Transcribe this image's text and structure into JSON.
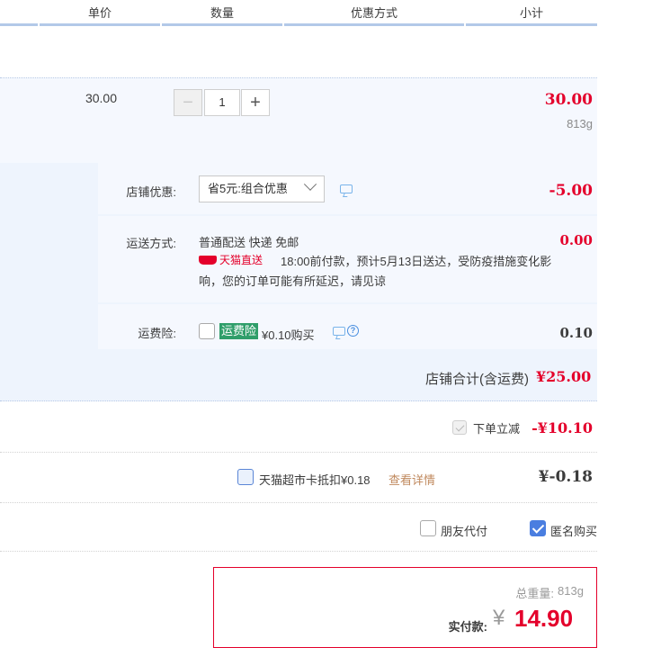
{
  "header": {
    "col_price": "单价",
    "col_qty": "数量",
    "col_discount": "优惠方式",
    "col_subtotal": "小计"
  },
  "item": {
    "unit_price": "30.00",
    "qty_minus": "−",
    "quantity": "1",
    "qty_plus": "+",
    "subtotal": "30.00",
    "weight": "813g"
  },
  "shop_discount": {
    "label": "店铺优惠:",
    "selected": "省5元:组合优惠",
    "amount": "-5.00"
  },
  "shipping": {
    "label": "运送方式:",
    "method": "普通配送 快递 免邮",
    "badge": "天猫直送",
    "notice_line1": "18:00前付款，预计5月13日送达，受防疫措施变化影",
    "notice_line2": "响，您的订单可能有所延迟，请见谅",
    "amount": "0.00"
  },
  "insurance": {
    "label": "运费险:",
    "badge": "运费险",
    "price_text": "¥0.10购买",
    "help_glyph": "?",
    "amount": "0.10"
  },
  "shop_total": {
    "label": "店铺合计(含运费)",
    "amount": "¥25.00"
  },
  "instant_discount": {
    "label": "下单立减",
    "amount": "-¥10.10"
  },
  "supermarket_card": {
    "label": "天猫超市卡抵扣¥0.18",
    "details_link": "查看详情",
    "amount": "¥-0.18"
  },
  "options": {
    "friend_pay": "朋友代付",
    "anonymous": "匿名购买"
  },
  "summary": {
    "weight_label": "总重量:",
    "weight_value": "813g",
    "pay_label": "实付款:",
    "currency": "¥",
    "pay_amount": "14.90"
  },
  "colors": {
    "accent_red": "#e4002b",
    "accent_blue": "#4a7ee0",
    "row_bg": "#f5f8fe",
    "insurance_green": "#2f9e6a"
  }
}
